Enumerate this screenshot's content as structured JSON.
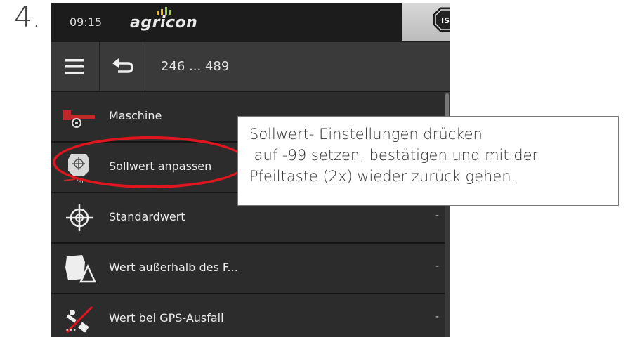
{
  "step_number": "4.",
  "status": {
    "time": "09:15",
    "brand": "agricon",
    "iso_label": "IS"
  },
  "toolbar": {
    "range": "246 ... 489"
  },
  "menu_items": [
    {
      "label": "Maschine",
      "icon": "machine-icon",
      "value": ""
    },
    {
      "label": "Sollwert anpassen",
      "icon": "target-adjust-icon",
      "value": ""
    },
    {
      "label": "Standardwert",
      "icon": "crosshair-icon",
      "value": "-"
    },
    {
      "label": "Wert außerhalb des F...",
      "icon": "field-outside-icon",
      "value": "-"
    },
    {
      "label": "Wert bei GPS-Ausfall",
      "icon": "gps-off-icon",
      "value": "-"
    }
  ],
  "callout": {
    "line1": "Sollwert- Einstellungen drücken",
    "line2": " auf -99 setzen, bestätigen und mit der",
    "line3": "Pfeiltaste (2x) wieder zurück gehen."
  },
  "colors": {
    "highlight": "#e0161e",
    "machine_red": "#c0282a"
  }
}
